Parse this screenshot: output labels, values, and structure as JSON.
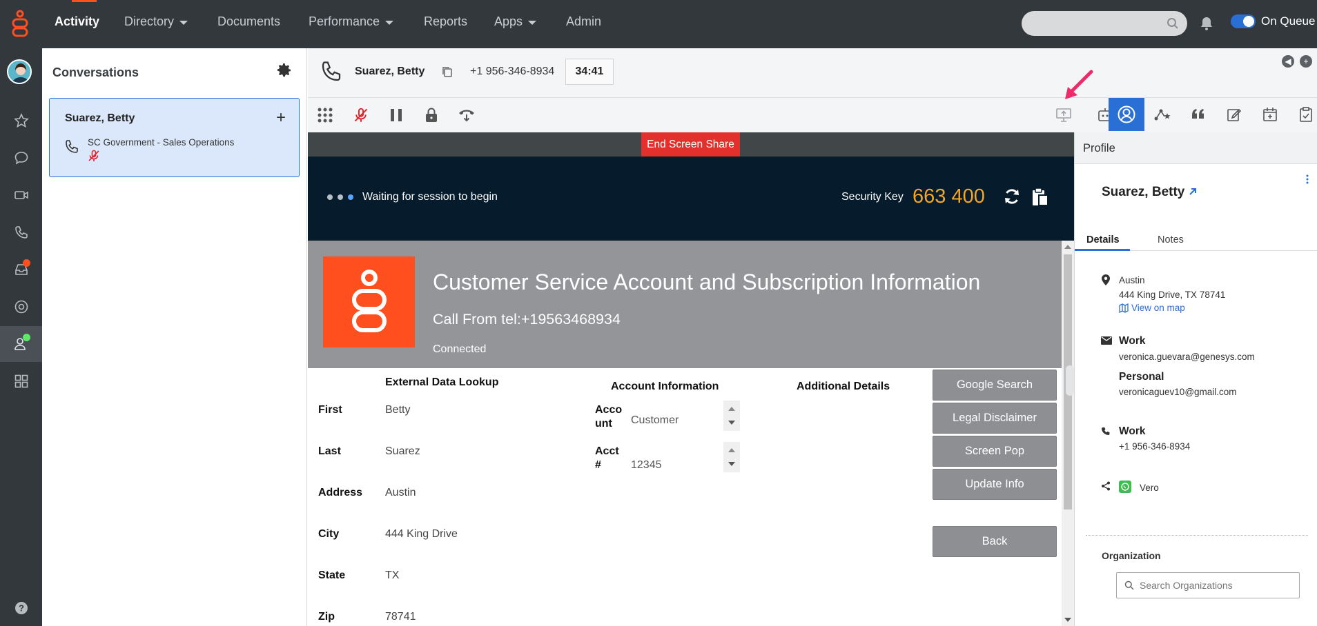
{
  "topnav": {
    "items": [
      {
        "label": "Activity"
      },
      {
        "label": "Directory"
      },
      {
        "label": "Documents"
      },
      {
        "label": "Performance"
      },
      {
        "label": "Reports"
      },
      {
        "label": "Apps"
      },
      {
        "label": "Admin"
      }
    ],
    "queue_label": "On Queue",
    "accent": "#ff4f1f"
  },
  "conversations": {
    "title": "Conversations",
    "card": {
      "name": "Suarez, Betty",
      "queue": "SC Government - Sales Operations"
    }
  },
  "interaction": {
    "name": "Suarez, Betty",
    "number": "+1 956-346-8934",
    "timer": "34:41"
  },
  "screen_share": {
    "end_label": "End Screen Share",
    "waiting": "Waiting for session to begin",
    "security_label": "Security Key",
    "security_key": "663 400",
    "key_color": "#f5a623"
  },
  "remote_page": {
    "title": "Customer Service Account and Subscription Information",
    "call_from": "Call From tel:+19563468934",
    "status": "Connected",
    "headers": {
      "external": "External Data Lookup",
      "account": "Account Information",
      "additional": "Additional Details"
    },
    "fields": [
      {
        "label": "First",
        "value": "Betty"
      },
      {
        "label": "Last",
        "value": "Suarez"
      },
      {
        "label": "Address",
        "value": "Austin"
      },
      {
        "label": "City",
        "value": "444 King Drive"
      },
      {
        "label": "State",
        "value": "TX"
      },
      {
        "label": "Zip",
        "value": "78741"
      }
    ],
    "account_fields": [
      {
        "label_line1": "Acco",
        "label_line2": "unt",
        "value": "Customer"
      },
      {
        "label_line1": "Acct",
        "label_line2": "#",
        "value": "12345"
      }
    ],
    "buttons": {
      "google": "Google Search",
      "legal": "Legal Disclaimer",
      "screenpop": "Screen Pop",
      "update": "Update Info",
      "back": "Back"
    }
  },
  "profile": {
    "header": "Profile",
    "name": "Suarez, Betty",
    "tabs": {
      "details": "Details",
      "notes": "Notes"
    },
    "address_line1": "Austin",
    "address_line2": "444 King Drive, TX 78741",
    "map_link": "View on map",
    "email_work_label": "Work",
    "email_work": "veronica.guevara@genesys.com",
    "email_personal_label": "Personal",
    "email_personal": "veronicaguev10@gmail.com",
    "phone_label": "Work",
    "phone": "+1 956-346-8934",
    "social": "Vero",
    "org_label": "Organization",
    "org_placeholder": "Search Organizations"
  }
}
